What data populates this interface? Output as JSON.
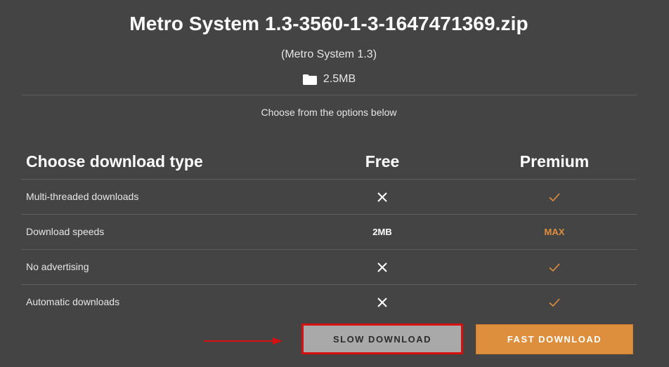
{
  "file": {
    "title": "Metro System 1.3-3560-1-3-1647471369.zip",
    "subtitle": "(Metro System 1.3)",
    "size": "2.5MB",
    "size_icon": "folder-icon"
  },
  "instructions": "Choose from the options below",
  "table": {
    "header": {
      "type_label": "Choose download type",
      "free_label": "Free",
      "premium_label": "Premium"
    },
    "rows": [
      {
        "label": "Multi-threaded downloads",
        "free": {
          "kind": "icon",
          "icon": "cross-icon"
        },
        "premium": {
          "kind": "icon",
          "icon": "check-icon"
        }
      },
      {
        "label": "Download speeds",
        "free": {
          "kind": "text",
          "text": "2MB"
        },
        "premium": {
          "kind": "text",
          "text": "MAX"
        }
      },
      {
        "label": "No advertising",
        "free": {
          "kind": "icon",
          "icon": "cross-icon"
        },
        "premium": {
          "kind": "icon",
          "icon": "check-icon"
        }
      },
      {
        "label": "Automatic downloads",
        "free": {
          "kind": "icon",
          "icon": "cross-icon"
        },
        "premium": {
          "kind": "icon",
          "icon": "check-icon"
        }
      }
    ]
  },
  "buttons": {
    "slow_label": "SLOW DOWNLOAD",
    "fast_label": "FAST DOWNLOAD"
  },
  "colors": {
    "background": "#444444",
    "accent": "#dd8f3e",
    "highlight": "#d80f0f"
  }
}
